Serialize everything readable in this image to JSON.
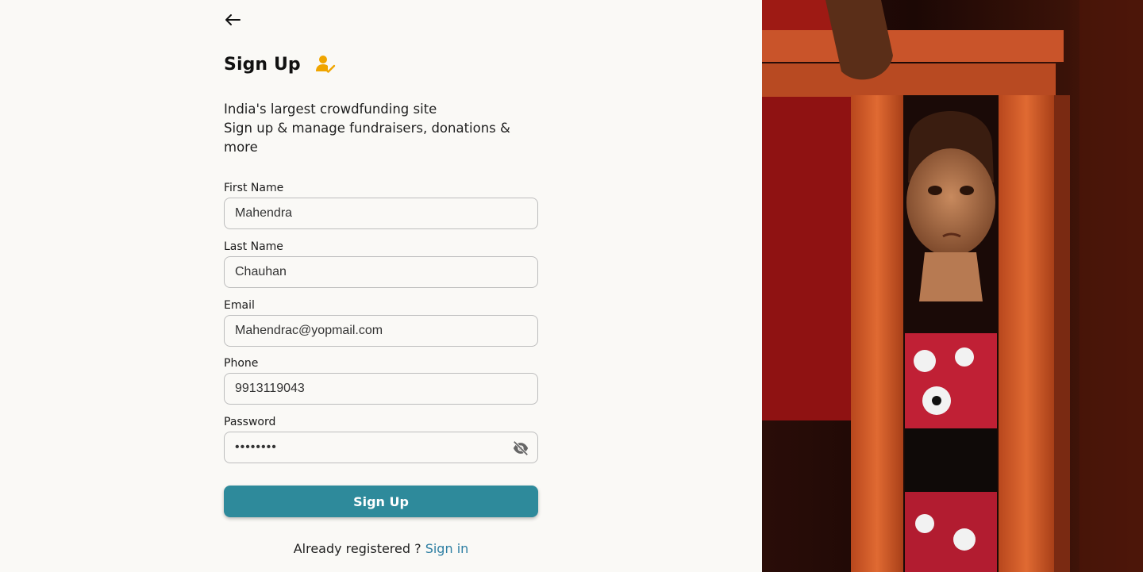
{
  "header": {
    "back_icon": "arrow-left-icon",
    "title": "Sign Up",
    "title_icon": "person-check-icon",
    "title_icon_color": "#f0a500"
  },
  "intro": {
    "line1": "India's largest crowdfunding site",
    "line2": "Sign up & manage fundraisers, donations & more"
  },
  "form": {
    "first_name": {
      "label": "First Name",
      "value": "Mahendra"
    },
    "last_name": {
      "label": "Last Name",
      "value": "Chauhan"
    },
    "email": {
      "label": "Email",
      "value": "Mahendrac@yopmail.com"
    },
    "phone": {
      "label": "Phone",
      "value": "9913119043"
    },
    "password": {
      "label": "Password",
      "value": "••••••••",
      "toggle_icon": "eye-off-icon"
    },
    "submit_label": "Sign Up"
  },
  "footer": {
    "text": "Already registered ? ",
    "link": "Sign in"
  },
  "colors": {
    "accent": "#2e8a9b",
    "link": "#2e7fa3",
    "background": "#faf9f6"
  },
  "hero_image": {
    "description_icon": "photo-icon"
  }
}
